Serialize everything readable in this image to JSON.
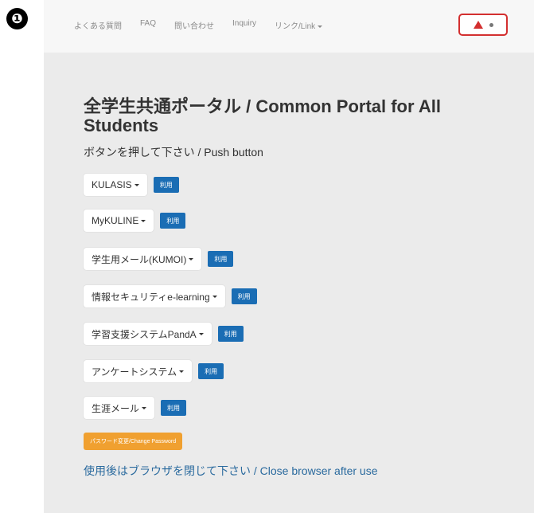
{
  "badge": "❶",
  "nav": {
    "links": [
      "よくある質問",
      "FAQ",
      "問い合わせ",
      "Inquiry"
    ],
    "dropdown_label": "リンク/Link"
  },
  "alert": {
    "icon": "warning-triangle-icon"
  },
  "main": {
    "title": "全学生共通ポータル / Common Portal for All Students",
    "subtitle": "ボタンを押して下さい / Push button",
    "use_label": "利用",
    "systems": [
      "KULASIS",
      "MyKULINE",
      "学生用メール(KUMOI)",
      "情報セキュリティe-learning",
      "学習支援システムPandA",
      "アンケートシステム",
      "生涯メール"
    ],
    "password_button": "パスワード変更/Change Password",
    "close_message": "使用後はブラウザを閉じて下さい / Close browser after use"
  },
  "colors": {
    "alert": "#d32f2f",
    "use_button": "#1a6db4",
    "password_button": "#f0a030",
    "close_text": "#2a6a9e"
  }
}
